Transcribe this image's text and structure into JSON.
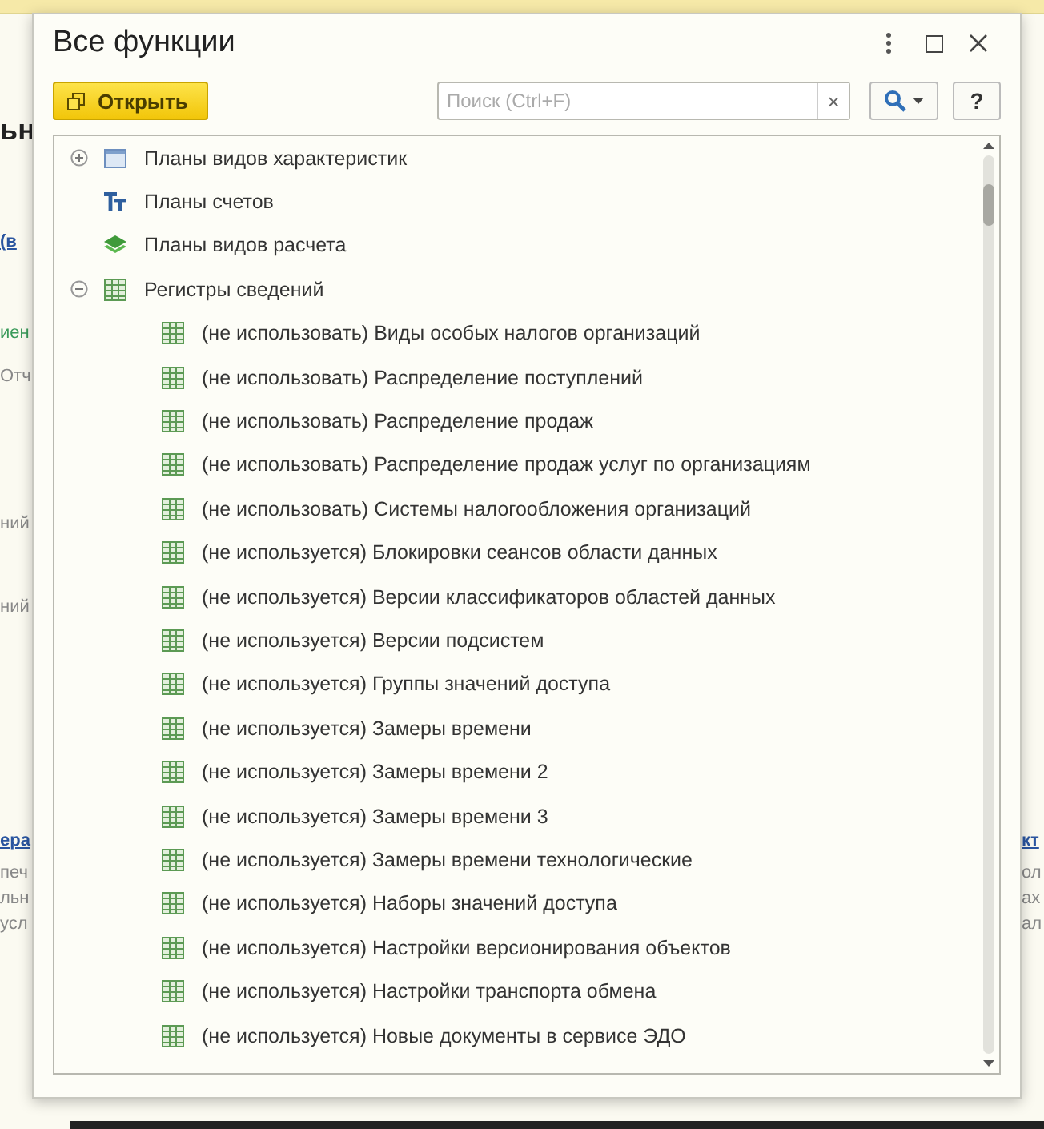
{
  "background": {
    "left_fragments": [
      "ьн",
      "(в",
      "иен",
      "Отч",
      "ний",
      "ний",
      "ера",
      "печ",
      "льн",
      "усл"
    ],
    "right_fragments": [
      "кт",
      "ол",
      "ах",
      "ал"
    ]
  },
  "dialog": {
    "title": "Все функции",
    "open_button": "Открыть",
    "search": {
      "placeholder": "Поиск (Ctrl+F)"
    },
    "clear_button": "×",
    "help_button": "?"
  },
  "tree": [
    {
      "label": "Планы видов характеристик",
      "kind": "characteristics",
      "expanded": false
    },
    {
      "label": "Планы счетов",
      "kind": "accounts"
    },
    {
      "label": "Планы видов расчета",
      "kind": "calculation"
    },
    {
      "label": "Регистры сведений",
      "kind": "register",
      "expanded": true,
      "children": [
        {
          "label": "(не использовать) Виды особых налогов организаций",
          "kind": "register"
        },
        {
          "label": "(не использовать) Распределение поступлений",
          "kind": "register"
        },
        {
          "label": "(не использовать) Распределение продаж",
          "kind": "register"
        },
        {
          "label": "(не использовать) Распределение продаж услуг по организациям",
          "kind": "register"
        },
        {
          "label": "(не использовать) Системы налогообложения организаций",
          "kind": "register"
        },
        {
          "label": "(не используется) Блокировки сеансов области данных",
          "kind": "register"
        },
        {
          "label": "(не используется) Версии классификаторов областей данных",
          "kind": "register"
        },
        {
          "label": "(не используется) Версии подсистем",
          "kind": "register"
        },
        {
          "label": "(не используется) Группы значений доступа",
          "kind": "register"
        },
        {
          "label": "(не используется) Замеры времени",
          "kind": "register"
        },
        {
          "label": "(не используется) Замеры времени 2",
          "kind": "register"
        },
        {
          "label": "(не используется) Замеры времени 3",
          "kind": "register"
        },
        {
          "label": "(не используется) Замеры времени технологические",
          "kind": "register"
        },
        {
          "label": "(не используется) Наборы значений доступа",
          "kind": "register"
        },
        {
          "label": "(не используется) Настройки версионирования объектов",
          "kind": "register"
        },
        {
          "label": "(не используется) Настройки транспорта обмена",
          "kind": "register"
        },
        {
          "label": "(не используется) Новые документы в сервисе ЭДО",
          "kind": "register"
        }
      ]
    }
  ]
}
